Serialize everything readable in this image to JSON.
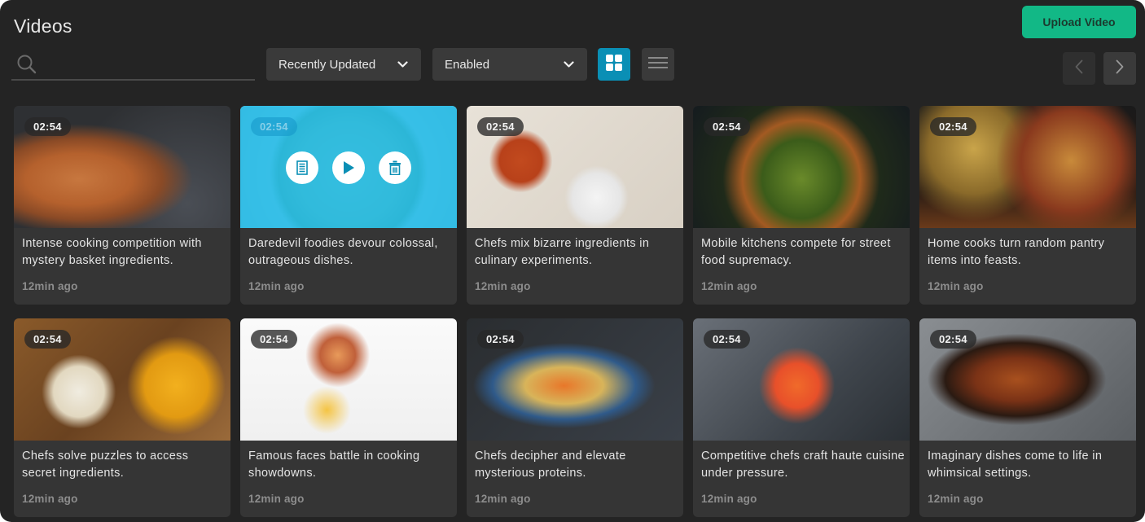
{
  "header": {
    "title": "Videos",
    "upload_label": "Upload Video",
    "accent_color": "#12b886"
  },
  "toolbar": {
    "search": {
      "value": "",
      "placeholder": "",
      "icon": "search-icon"
    },
    "sort_select": {
      "selected": "Recently Updated",
      "icon": "chevron-down-icon"
    },
    "status_select": {
      "selected": "Enabled",
      "icon": "chevron-down-icon"
    },
    "view_modes": [
      {
        "name": "grid",
        "icon": "grid-icon",
        "active": true
      },
      {
        "name": "list",
        "icon": "list-icon",
        "active": false
      }
    ],
    "pagination": {
      "prev_icon": "chevron-left-icon",
      "next_icon": "chevron-right-icon",
      "prev_enabled": false,
      "next_enabled": true
    }
  },
  "videos": [
    {
      "duration": "02:54",
      "title": "Intense cooking competition with mystery basket ingredients.",
      "updated": "12min ago",
      "thumbnail": "pizza",
      "hover": false
    },
    {
      "duration": "02:54",
      "title": "Daredevil foodies devour colossal, outrageous dishes.",
      "updated": "12min ago",
      "thumbnail": "soup-bowl",
      "hover": true,
      "actions": [
        {
          "label": "details",
          "icon": "document-icon"
        },
        {
          "label": "play",
          "icon": "play-icon"
        },
        {
          "label": "delete",
          "icon": "trash-icon"
        }
      ]
    },
    {
      "duration": "02:54",
      "title": "Chefs mix bizarre ingredients in culinary experiments.",
      "updated": "12min ago",
      "thumbnail": "spice-spoons",
      "hover": false
    },
    {
      "duration": "02:54",
      "title": "Mobile kitchens compete for street food supremacy.",
      "updated": "12min ago",
      "thumbnail": "salad",
      "hover": false
    },
    {
      "duration": "02:54",
      "title": "Home cooks turn random pantry items into feasts.",
      "updated": "12min ago",
      "thumbnail": "burger-fries",
      "hover": false
    },
    {
      "duration": "02:54",
      "title": "Chefs solve puzzles to access secret ingredients.",
      "updated": "12min ago",
      "thumbnail": "platter",
      "hover": false
    },
    {
      "duration": "02:54",
      "title": "Famous faces battle in cooking showdowns.",
      "updated": "12min ago",
      "thumbnail": "brunch-table",
      "hover": false
    },
    {
      "duration": "02:54",
      "title": "Chefs decipher and elevate mysterious proteins.",
      "updated": "12min ago",
      "thumbnail": "noodle-bowl",
      "hover": false
    },
    {
      "duration": "02:54",
      "title": "Competitive chefs craft haute cuisine under pressure.",
      "updated": "12min ago",
      "thumbnail": "cocktail",
      "hover": false
    },
    {
      "duration": "02:54",
      "title": "Imaginary dishes come to life in whimsical settings.",
      "updated": "12min ago",
      "thumbnail": "roast-pan",
      "hover": false
    }
  ]
}
